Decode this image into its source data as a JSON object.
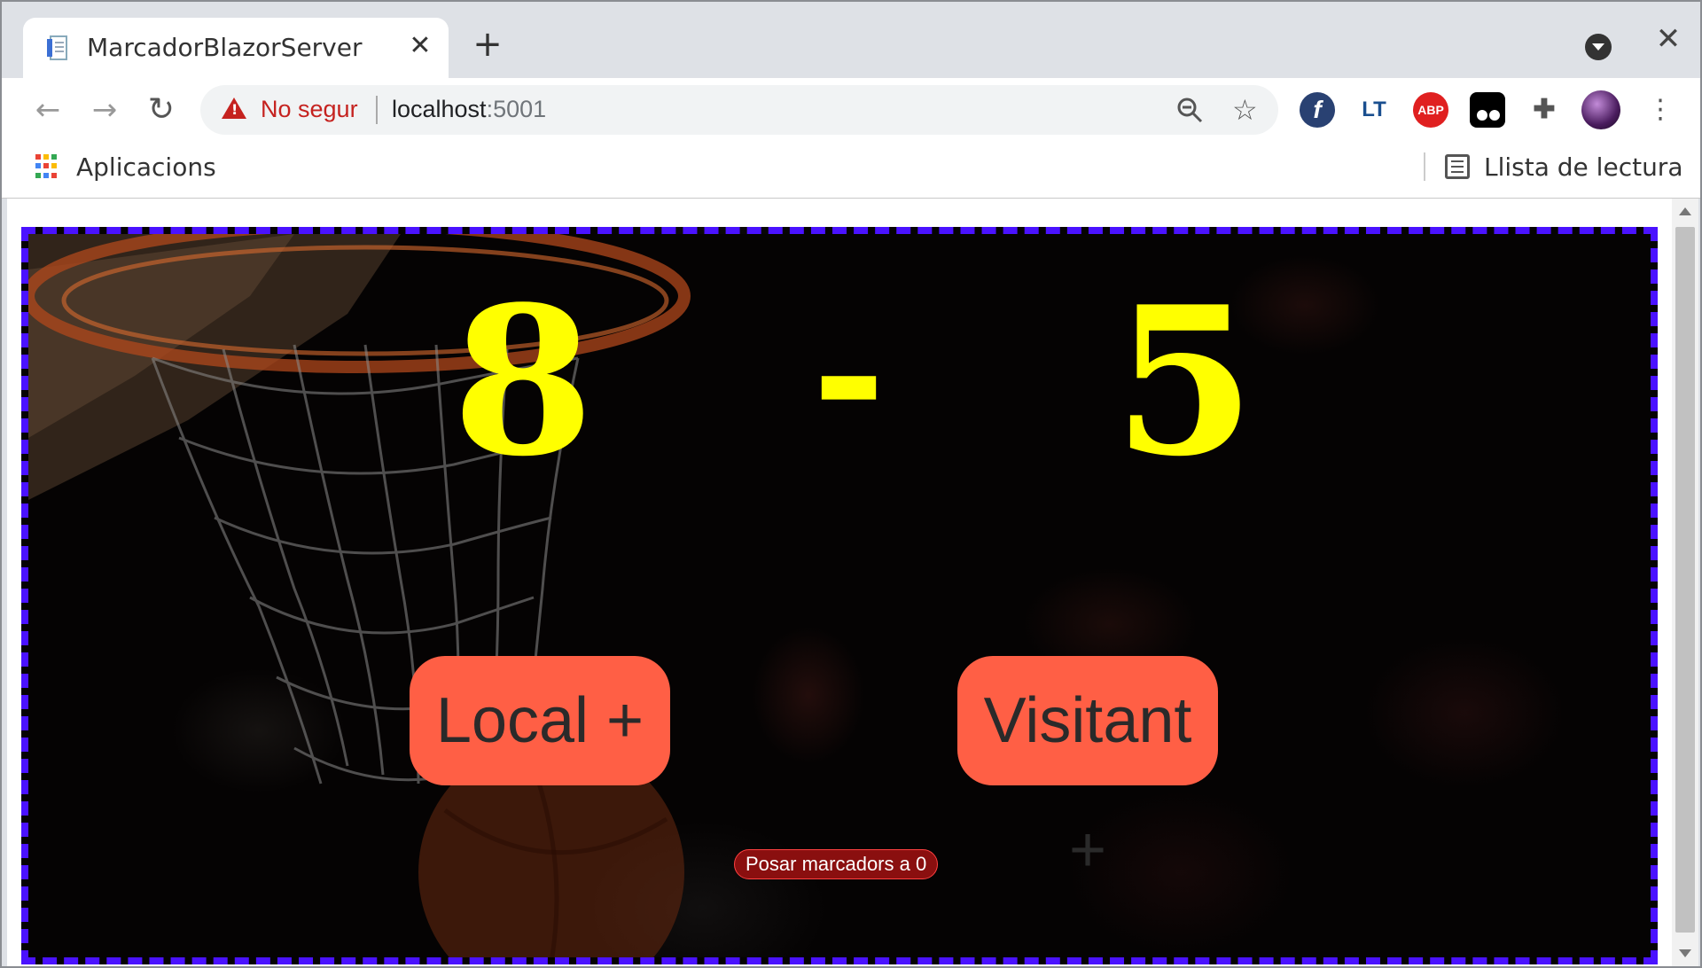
{
  "browser": {
    "tab_title": "MarcadorBlazorServer",
    "tab_close": "✕",
    "new_tab": "+",
    "window_close": "✕",
    "security_label": "No segur",
    "url_host": "localhost",
    "url_port": ":5001",
    "nav": {
      "back": "←",
      "forward": "→",
      "reload": "↻"
    },
    "star": "☆",
    "menu": "⋮",
    "extensions": [
      {
        "name": "fedora-icon",
        "label": "f"
      },
      {
        "name": "languagetool-icon",
        "label": "LT"
      },
      {
        "name": "adblock-plus-icon",
        "label": "ABP"
      },
      {
        "name": "tampermonkey-icon",
        "label": ""
      },
      {
        "name": "extensions-puzzle-icon",
        "label": "✚"
      }
    ]
  },
  "bookmarks": {
    "apps_label": "Aplicacions",
    "reading_list_label": "Llista de lectura"
  },
  "scoreboard": {
    "local_score": "8",
    "separator": "-",
    "visitor_score": "5",
    "local_button": "Local +",
    "visitor_button": "Visitant +",
    "reset_button": "Posar marcadors a 0"
  },
  "colors": {
    "score": "#ffff00",
    "button": "#ff5f45",
    "reset": "#8a0f0f",
    "border": "#4a12ff",
    "warning": "#c5221f"
  }
}
